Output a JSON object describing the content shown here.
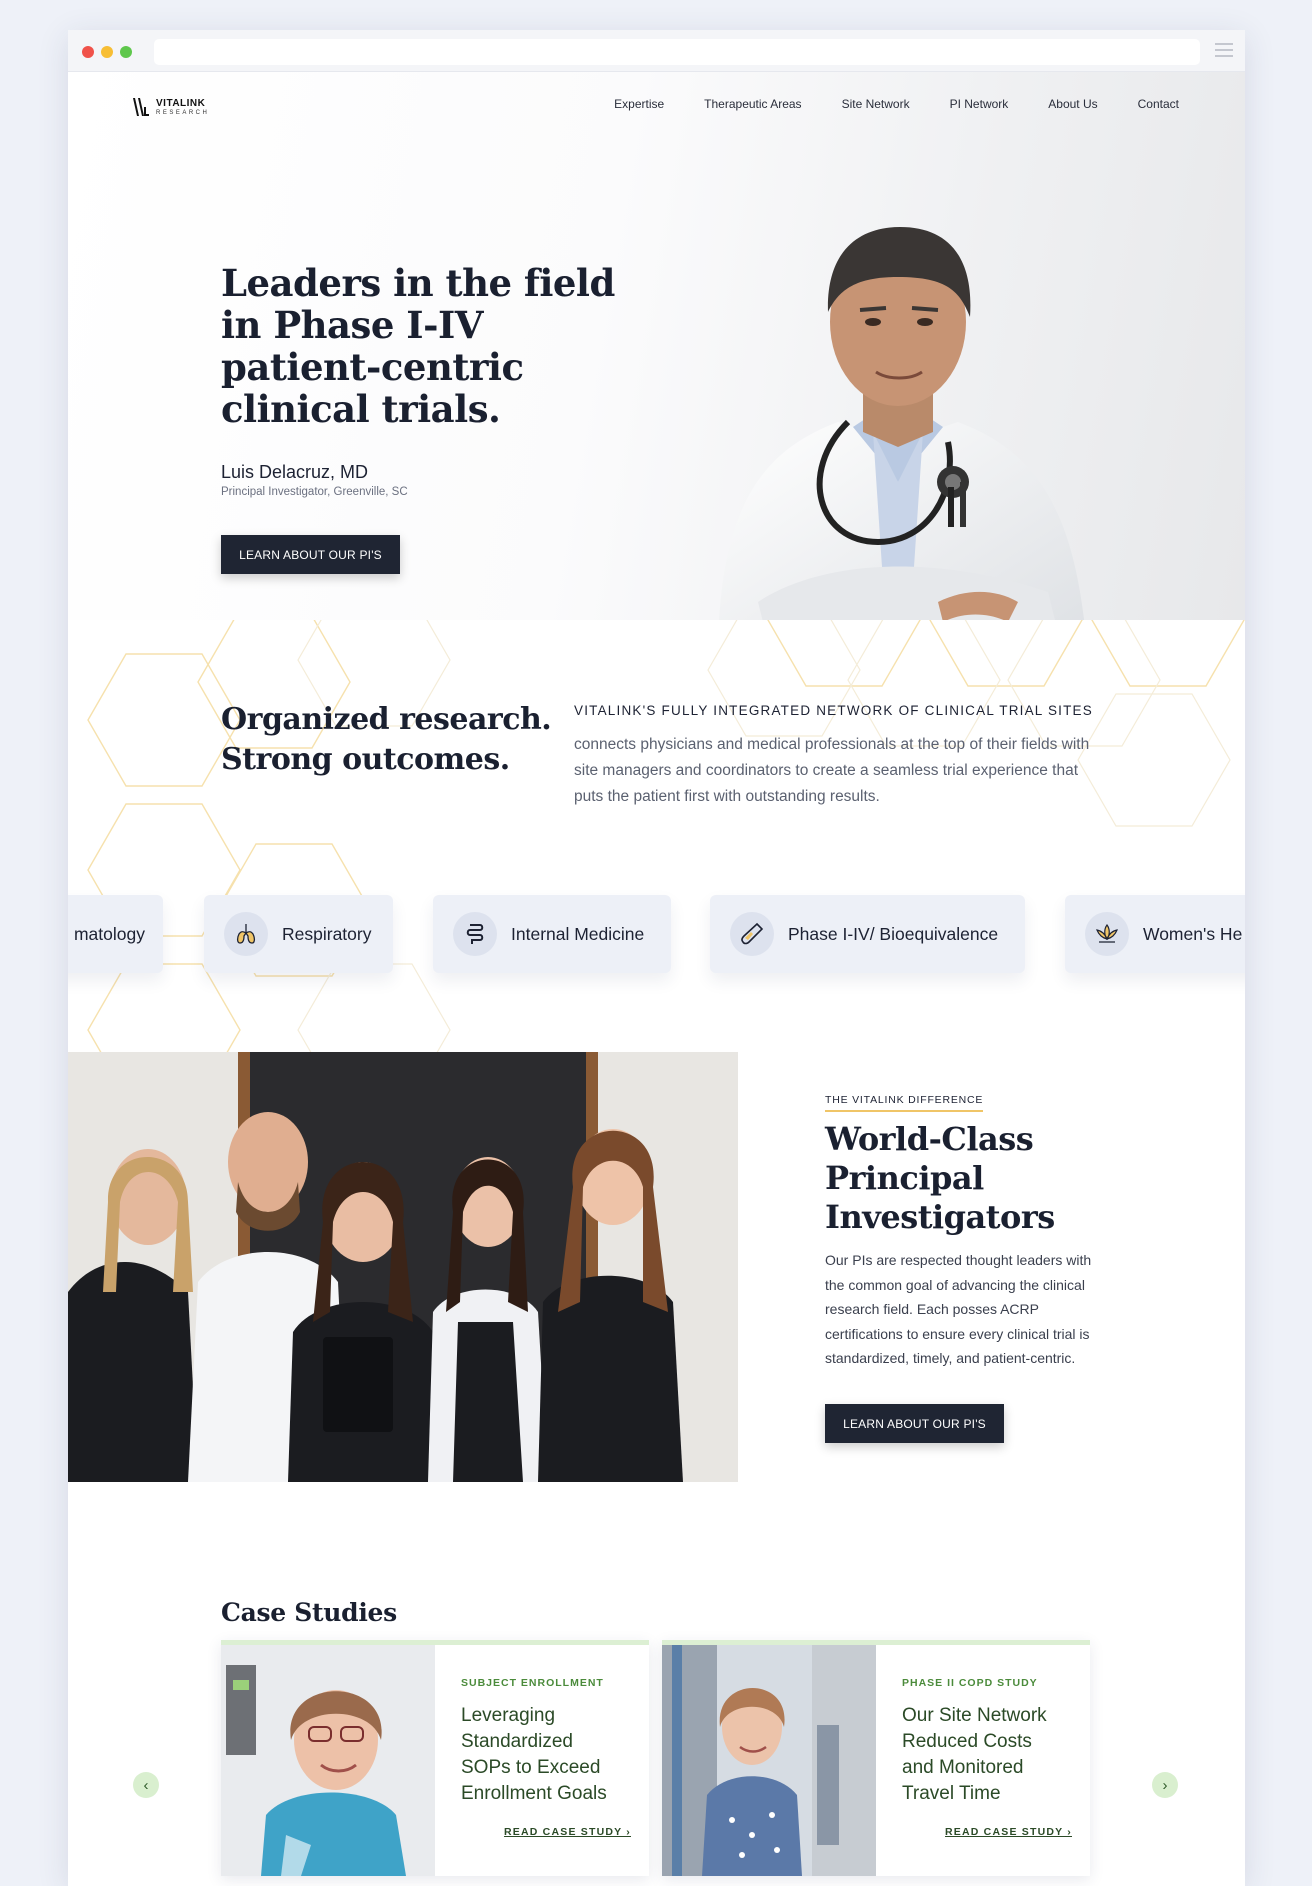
{
  "brand": {
    "name": "VITALINK",
    "sub": "RESEARCH"
  },
  "nav": [
    "Expertise",
    "Therapeutic Areas",
    "Site Network",
    "PI Network",
    "About Us",
    "Contact"
  ],
  "hero": {
    "title": "Leaders in the field in Phase I-IV patient-centric clinical trials.",
    "pi_name": "Luis Delacruz, MD",
    "pi_role": "Principal Investigator, Greenville, SC",
    "cta": "LEARN ABOUT OUR PI'S"
  },
  "organized": {
    "title_line1": "Organized research.",
    "title_line2": "Strong outcomes.",
    "kicker": "VITALINK'S FULLY INTEGRATED NETWORK OF CLINICAL TRIAL SITES",
    "body": "connects physicians and medical professionals at the top of their fields with site managers and coordinators to create a seamless trial experience that puts the patient first with outstanding results."
  },
  "therapeutic_areas": [
    {
      "label": "matology",
      "icon": "partial-icon"
    },
    {
      "label": "Respiratory",
      "icon": "lungs-icon"
    },
    {
      "label": "Internal Medicine",
      "icon": "intestine-icon"
    },
    {
      "label": "Phase I-IV/ Bioequivalence",
      "icon": "test-tube-icon"
    },
    {
      "label": "Women's He",
      "icon": "lotus-icon"
    }
  ],
  "difference": {
    "kicker": "THE VITALINK DIFFERENCE",
    "title": "World-Class Principal Investigators",
    "body": "Our PIs are respected thought leaders with the common goal of advancing the clinical research field. Each posses ACRP certifications to ensure every clinical trial is standardized, timely, and patient-centric.",
    "cta": "LEARN ABOUT OUR PI'S"
  },
  "case_studies": {
    "title": "Case Studies",
    "cards": [
      {
        "kicker": "SUBJECT ENROLLMENT",
        "title": "Leveraging Standardized SOPs to Exceed Enrollment Goals",
        "link": "READ CASE STUDY ›"
      },
      {
        "kicker": "PHASE II COPD STUDY",
        "title": "Our Site Network Reduced Costs and Monitored Travel Time",
        "link": "READ CASE STUDY ›"
      }
    ],
    "prev": "‹",
    "next": "›"
  },
  "colors": {
    "accent_dark": "#1f2533",
    "hex_gold": "#f0c567",
    "case_green": "#4b8b3b",
    "chip_bg": "#edf0f7"
  }
}
